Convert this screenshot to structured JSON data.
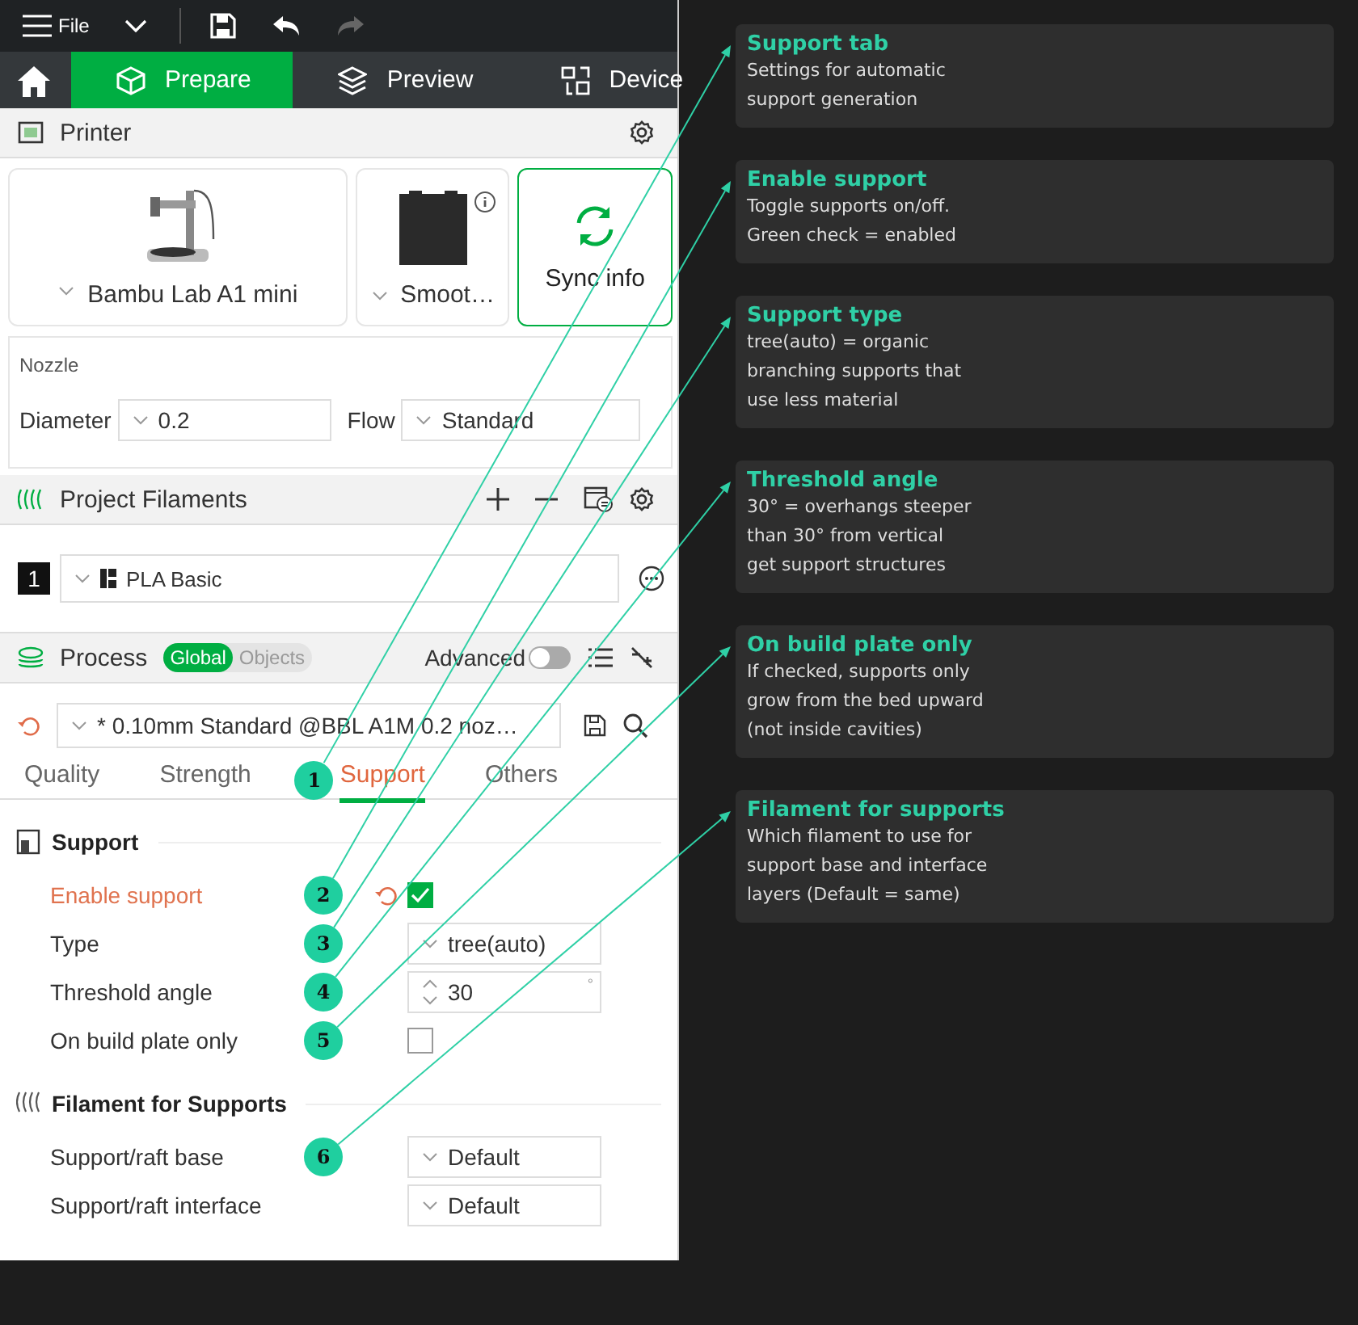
{
  "menu_bar": {
    "file_label": "File"
  },
  "nav_tabs": [
    {
      "label": "Prepare",
      "selected": true
    },
    {
      "label": "Preview",
      "selected": false
    },
    {
      "label": "Device",
      "selected": false
    }
  ],
  "printer": {
    "title": "Printer",
    "printer_name": "Bambu Lab A1 mini",
    "plate_name": "Smoot…",
    "sync_label": "Sync info",
    "nozzle_label": "Nozzle",
    "diameter_label": "Diameter",
    "diameter": "0.2",
    "flow_label": "Flow",
    "flow": "Standard"
  },
  "filaments": {
    "title": "Project Filaments",
    "items": [
      {
        "number": "1",
        "name": "PLA Basic"
      }
    ]
  },
  "process": {
    "title": "Process",
    "scope": [
      {
        "label": "Global",
        "selected": true
      },
      {
        "label": "Objects",
        "selected": false
      }
    ],
    "advanced_label": "Advanced",
    "advanced_on": false,
    "preset": "* 0.10mm Standard @BBL A1M 0.2 noz…",
    "tabs": [
      {
        "label": "Quality",
        "selected": false
      },
      {
        "label": "Strength",
        "selected": false
      },
      {
        "label": "Support",
        "selected": true,
        "badge": "1"
      },
      {
        "label": "Others",
        "selected": false
      }
    ],
    "sections": [
      {
        "title": "Support",
        "kind": "support",
        "rows": [
          {
            "label": "Enable support",
            "kind": "checkbox",
            "checked": true,
            "modified": true,
            "badge": "2"
          },
          {
            "label": "Type",
            "kind": "dropdown",
            "value": "tree(auto)",
            "badge": "3"
          },
          {
            "label": "Threshold angle",
            "kind": "spin",
            "value": "30",
            "unit": "°",
            "badge": "4"
          },
          {
            "label": "On build plate only",
            "kind": "checkbox",
            "checked": false,
            "badge": "5"
          }
        ]
      },
      {
        "title": "Filament for Supports",
        "kind": "filament",
        "rows": [
          {
            "label": "Support/raft base",
            "kind": "dropdown",
            "value": "Default",
            "badge": "6"
          },
          {
            "label": "Support/raft interface",
            "kind": "dropdown",
            "value": "Default"
          }
        ]
      }
    ]
  },
  "callouts": [
    {
      "title": "Support tab",
      "body": "Settings for automatic\nsupport generation"
    },
    {
      "title": "Enable support",
      "body": "Toggle supports on/off.\nGreen check = enabled"
    },
    {
      "title": "Support type",
      "body": "tree(auto) = organic\nbranching supports that\nuse less material"
    },
    {
      "title": "Threshold angle",
      "body": "30° = overhangs steeper\nthan 30° from vertical\nget support structures"
    },
    {
      "title": "On build plate only",
      "body": "If checked, supports only\ngrow from the bed upward\n(not inside cavities)"
    },
    {
      "title": "Filament for supports",
      "body": "Which filament to use for\nsupport base and interface\nlayers (Default = same)"
    }
  ]
}
